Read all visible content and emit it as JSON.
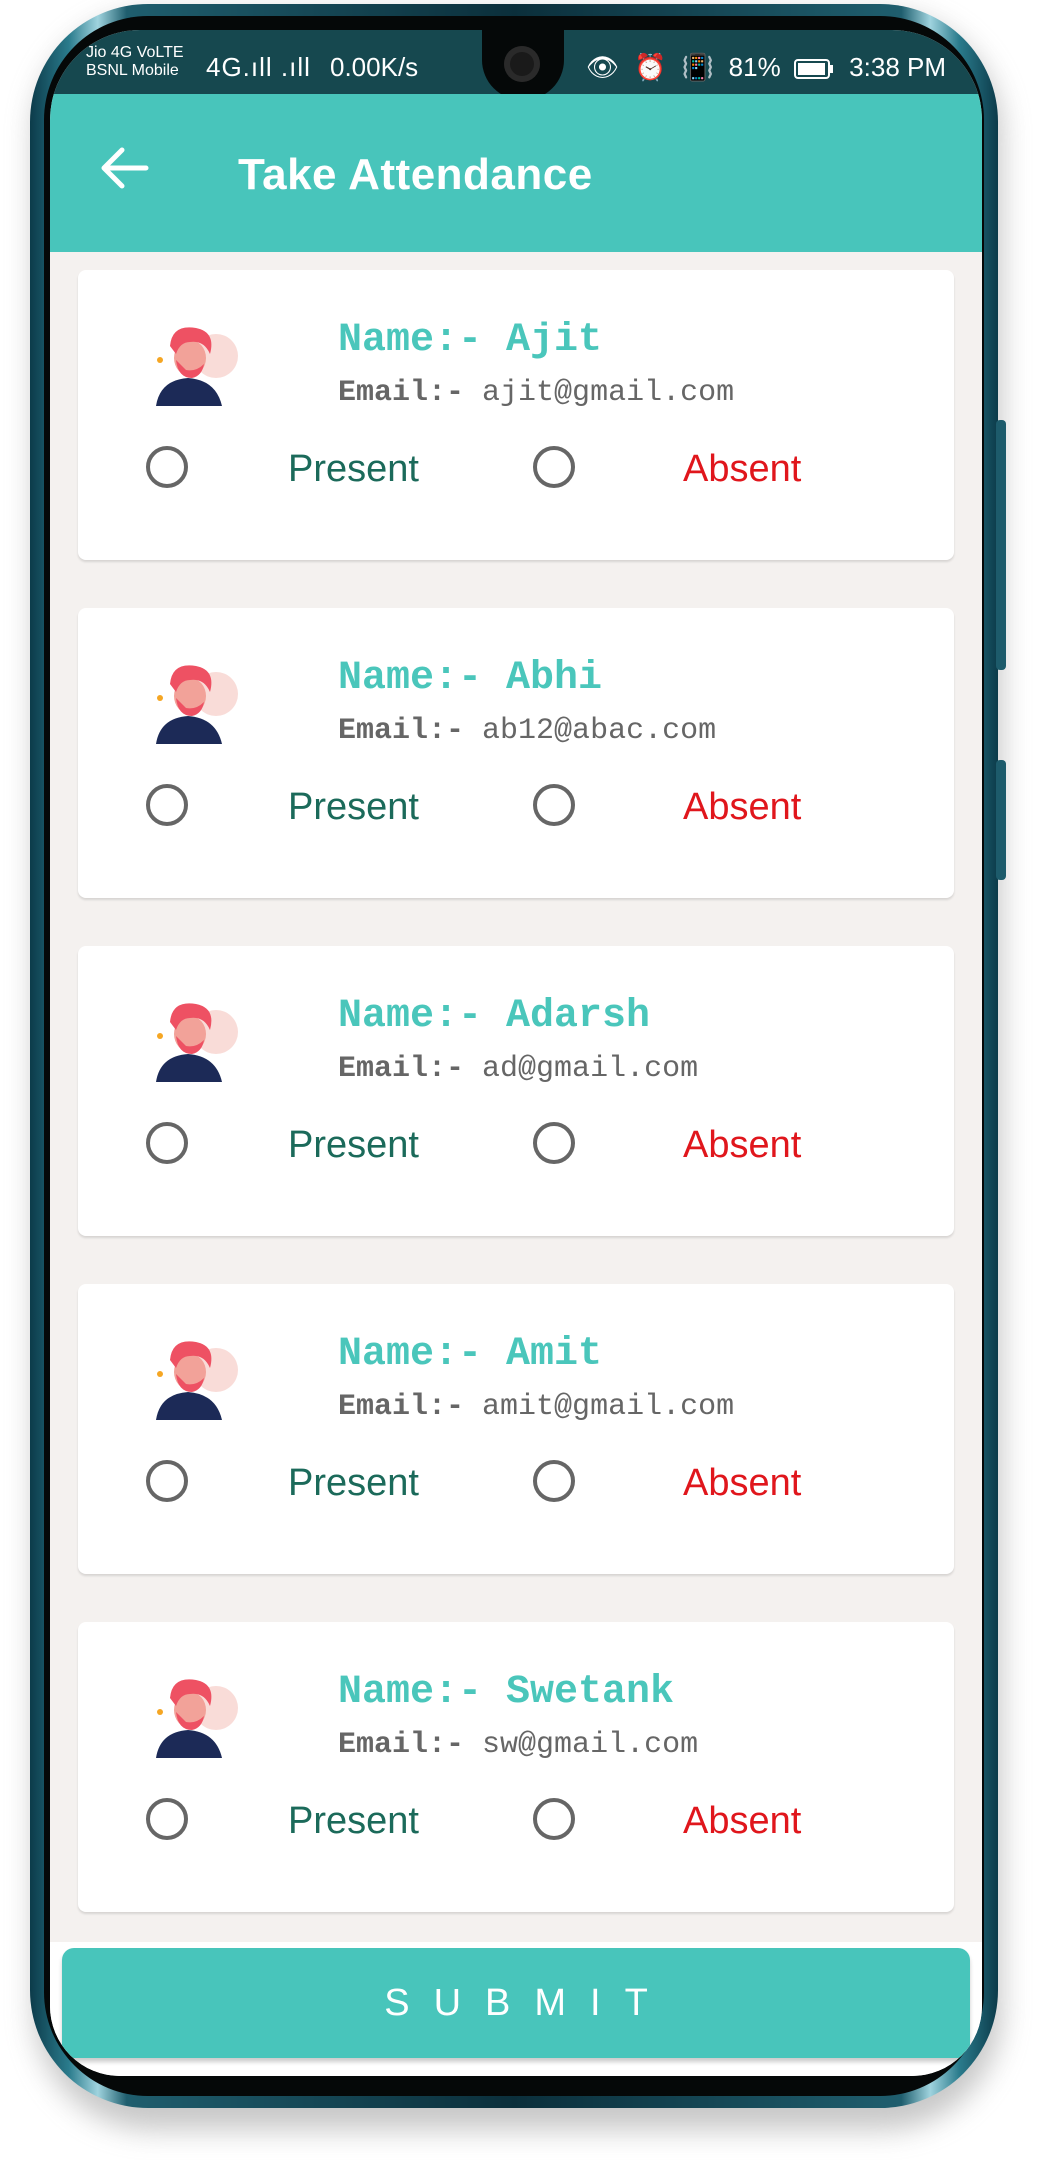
{
  "status_bar": {
    "carrier_top": "Jio 4G VoLTE",
    "carrier_bottom": "BSNL Mobile",
    "signals": "4G.ıll .ıll",
    "speed": "0.00K/s",
    "icons": "👁 ⏰ 📳",
    "battery": "81%",
    "time": "3:38 PM"
  },
  "app_bar": {
    "back_icon": "arrow-left-icon",
    "title": "Take Attendance"
  },
  "students": [
    {
      "name": "Name:- Ajit",
      "email_label": "Email:-",
      "email": "ajit@gmail.com",
      "present_label": "Present",
      "absent_label": "Absent"
    },
    {
      "name": "Name:- Abhi",
      "email_label": "Email:-",
      "email": "ab12@abac.com",
      "present_label": "Present",
      "absent_label": "Absent"
    },
    {
      "name": "Name:- Adarsh",
      "email_label": "Email:-",
      "email": "ad@gmail.com",
      "present_label": "Present",
      "absent_label": "Absent"
    },
    {
      "name": "Name:- Amit",
      "email_label": "Email:-",
      "email": "amit@gmail.com",
      "present_label": "Present",
      "absent_label": "Absent"
    },
    {
      "name": "Name:- Swetank",
      "email_label": "Email:-",
      "email": "sw@gmail.com",
      "present_label": "Present",
      "absent_label": "Absent"
    }
  ],
  "submit": {
    "label": "SUBMIT"
  },
  "colors": {
    "accent": "#48c5bb",
    "present_text": "#1b6a5a",
    "absent_text": "#e0161c",
    "status_bar": "#16484f"
  }
}
